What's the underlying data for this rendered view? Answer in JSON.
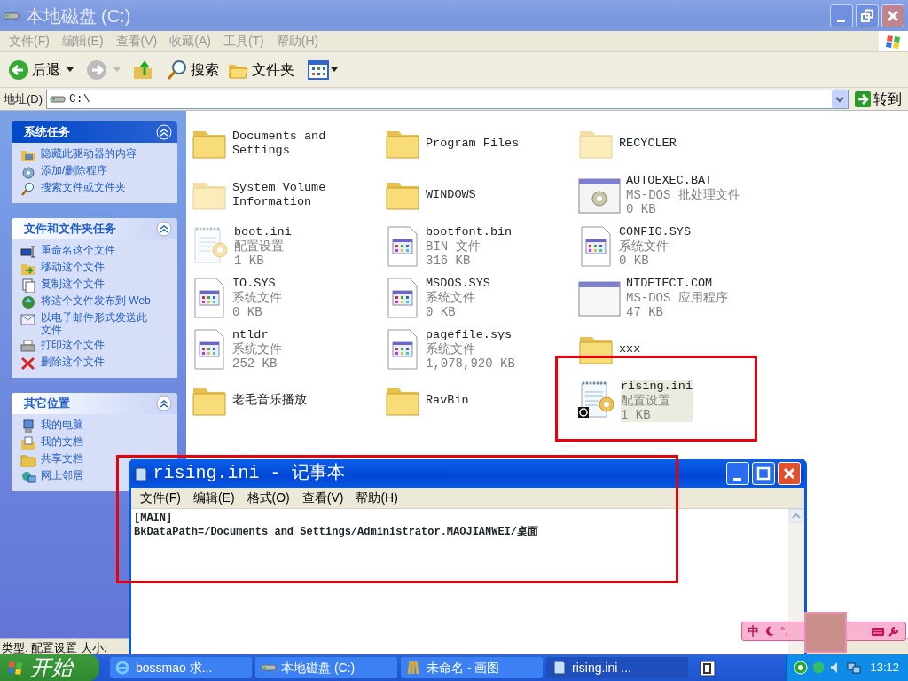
{
  "explorer": {
    "title": "本地磁盘 (C:)",
    "active": false,
    "menu": [
      "文件(F)",
      "编辑(E)",
      "查看(V)",
      "收藏(A)",
      "工具(T)",
      "帮助(H)"
    ],
    "toolbar": {
      "back": "后退",
      "forward_disabled": true,
      "search": "搜索",
      "folders": "文件夹"
    },
    "address": {
      "label": "地址(D)",
      "value": "C:\\",
      "go": "转到"
    },
    "task_panels": [
      {
        "title": "系统任务",
        "items": [
          {
            "kind": "hide",
            "label": "隐藏此驱动器的内容"
          },
          {
            "kind": "programs",
            "label": "添加/删除程序"
          },
          {
            "kind": "search",
            "label": "搜索文件或文件夹"
          }
        ]
      },
      {
        "title": "文件和文件夹任务",
        "items": [
          {
            "kind": "rename",
            "label": "重命名这个文件"
          },
          {
            "kind": "move",
            "label": "移动这个文件"
          },
          {
            "kind": "copy",
            "label": "复制这个文件"
          },
          {
            "kind": "web",
            "label": "将这个文件发布到 Web"
          },
          {
            "kind": "mail",
            "label": "以电子邮件形式发送此文件"
          },
          {
            "kind": "print",
            "label": "打印这个文件"
          },
          {
            "kind": "delete",
            "label": "删除这个文件"
          }
        ]
      },
      {
        "title": "其它位置",
        "items": [
          {
            "kind": "computer",
            "label": "我的电脑"
          },
          {
            "kind": "documents",
            "label": "我的文档"
          },
          {
            "kind": "shared",
            "label": "共享文档"
          },
          {
            "kind": "network",
            "label": "网上邻居"
          }
        ]
      }
    ],
    "file_rows": [
      {
        "items": [
          {
            "kind": "folder",
            "name": "Documents and Settings",
            "hidden": false,
            "selected": false,
            "badge": false,
            "highlighted": false
          },
          {
            "kind": "folder",
            "name": "Program Files",
            "hidden": false,
            "selected": false,
            "badge": false,
            "highlighted": false
          },
          {
            "kind": "folder",
            "name": "RECYCLER",
            "hidden": true,
            "selected": false,
            "badge": false,
            "highlighted": false
          }
        ]
      },
      {
        "items": [
          {
            "kind": "folder",
            "name": "System Volume Information",
            "hidden": true,
            "selected": false,
            "badge": false,
            "highlighted": false
          },
          {
            "kind": "folder",
            "name": "WINDOWS",
            "hidden": false,
            "selected": false,
            "badge": false,
            "highlighted": false
          },
          {
            "kind": "bat",
            "name": "AUTOEXEC.BAT",
            "type": "MS-DOS 批处理文件",
            "size": "0 KB",
            "hidden": false,
            "selected": false,
            "badge": false,
            "highlighted": false
          }
        ]
      },
      {
        "items": [
          {
            "kind": "ini",
            "name": "boot.ini",
            "type": "配置设置",
            "size": "1 KB",
            "hidden": true,
            "selected": false,
            "badge": false,
            "highlighted": false
          },
          {
            "kind": "sys",
            "name": "bootfont.bin",
            "type": "BIN 文件",
            "size": "316 KB",
            "hidden": false,
            "selected": false,
            "badge": false,
            "highlighted": false
          },
          {
            "kind": "sys",
            "name": "CONFIG.SYS",
            "type": "系统文件",
            "size": "0 KB",
            "hidden": false,
            "selected": false,
            "badge": false,
            "highlighted": false
          }
        ]
      },
      {
        "items": [
          {
            "kind": "sys",
            "name": "IO.SYS",
            "type": "系统文件",
            "size": "0 KB",
            "hidden": false,
            "selected": false,
            "badge": false,
            "highlighted": false
          },
          {
            "kind": "sys",
            "name": "MSDOS.SYS",
            "type": "系统文件",
            "size": "0 KB",
            "hidden": false,
            "selected": false,
            "badge": false,
            "highlighted": false
          },
          {
            "kind": "com",
            "name": "NTDETECT.COM",
            "type": "MS-DOS 应用程序",
            "size": "47 KB",
            "hidden": false,
            "selected": false,
            "badge": false,
            "highlighted": false
          }
        ]
      },
      {
        "items": [
          {
            "kind": "sys",
            "name": "ntldr",
            "type": "系统文件",
            "size": "252 KB",
            "hidden": false,
            "selected": false,
            "badge": false,
            "highlighted": false
          },
          {
            "kind": "sys",
            "name": "pagefile.sys",
            "type": "系统文件",
            "size": "1,078,920 KB",
            "hidden": false,
            "selected": false,
            "badge": false,
            "highlighted": false
          },
          {
            "kind": "folder",
            "name": "xxx",
            "hidden": false,
            "selected": false,
            "badge": false,
            "highlighted": false
          }
        ]
      },
      {
        "items": [
          {
            "kind": "folder",
            "name": "老毛音乐播放",
            "hidden": false,
            "selected": false,
            "badge": false,
            "highlighted": false
          },
          {
            "kind": "folder",
            "name": "RavBin",
            "hidden": false,
            "selected": false,
            "badge": false,
            "highlighted": false
          },
          {
            "kind": "ini",
            "name": "rising.ini",
            "type": "配置设置",
            "size": "1 KB",
            "hidden": false,
            "selected": true,
            "badge": true,
            "highlighted": true
          }
        ]
      }
    ],
    "status_bar": "类型: 配置设置 大小:"
  },
  "notepad": {
    "title": "rising.ini - 记事本",
    "active": true,
    "highlighted": true,
    "menu": [
      "文件(F)",
      "编辑(E)",
      "格式(O)",
      "查看(V)",
      "帮助(H)"
    ],
    "lines": [
      "[MAIN]",
      "BkDataPath=/Documents and Settings/Administrator.MAOJIANWEI/桌面"
    ]
  },
  "ime_bar": {
    "mode": "中",
    "punct": "°,"
  },
  "taskbar": {
    "start": "开始",
    "clock": "13:12",
    "tasks": [
      {
        "kind": "browser",
        "label": "bossmao 求...",
        "selected": false
      },
      {
        "kind": "drive",
        "label": "本地磁盘 (C:)",
        "selected": false
      },
      {
        "kind": "paint",
        "label": "未命名 - 画图",
        "selected": false
      },
      {
        "kind": "notepad",
        "label": "rising.ini ...",
        "selected": true
      }
    ]
  }
}
